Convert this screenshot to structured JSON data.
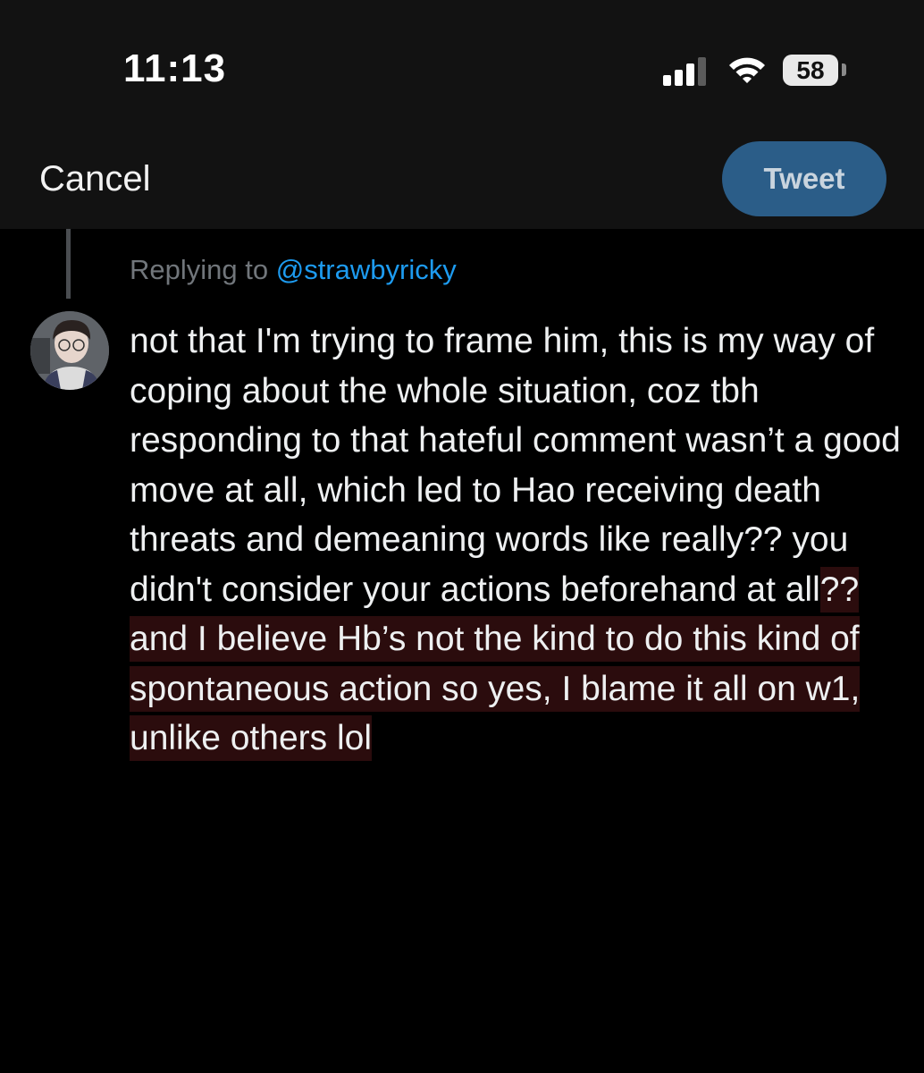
{
  "status_bar": {
    "time": "11:13",
    "battery_level": "58",
    "signal_bars_filled": 3,
    "signal_bars_total": 4
  },
  "nav": {
    "cancel_label": "Cancel",
    "tweet_label": "Tweet"
  },
  "compose": {
    "replying_prefix": "Replying to ",
    "replying_handle": "@strawbyricky",
    "text_plain": "not that I'm trying to frame him, this is my way of coping about the whole situation, coz tbh responding to that hateful comment wasn’t a good move at all, which led to Hao receiving death threats and demeaning words like really?? you didn't consider your actions beforehand at all",
    "text_highlighted": "?? and I believe Hb’s not the kind to do this kind of spontaneous action so yes, I blame it all on w1, unlike others lol"
  },
  "colors": {
    "background": "#000000",
    "bar_background": "#121212",
    "tweet_button": "#2b5d88",
    "mention": "#1d9bf0",
    "highlight": "#2b0c0d"
  },
  "icons": [
    "signal-icon",
    "wifi-icon",
    "battery-icon",
    "avatar"
  ]
}
